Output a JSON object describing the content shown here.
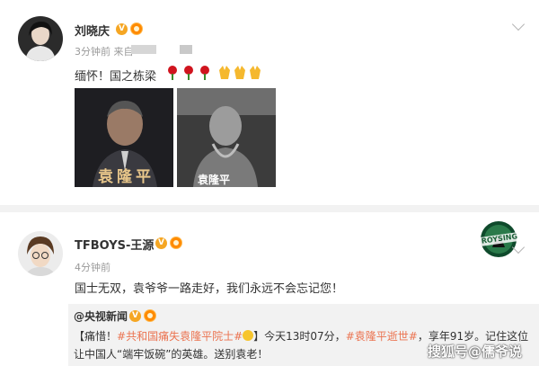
{
  "post1": {
    "author": "刘晓庆",
    "time": "3分钟前",
    "source_prefix": "来自",
    "text": "缅怀！国之栋梁",
    "emojis": [
      "rose",
      "rose",
      "rose",
      "praying-hands",
      "praying-hands",
      "praying-hands"
    ],
    "images": [
      {
        "caption": "袁隆平"
      },
      {
        "caption": "袁隆平"
      }
    ]
  },
  "post2": {
    "author": "TFBOYS-王源",
    "time": "4分钟前",
    "text": "国士无双，袁爷爷一路走好，我们永远不会忘记您！",
    "badge_text": "ROYSING",
    "repost": {
      "author": "@央视新闻",
      "line1_prefix": "【痛惜！",
      "line1_tag1": "#共和国痛失袁隆平院士#",
      "line1_mid": "】今天13时07分，",
      "line1_tag2": "#袁隆平逝世#",
      "line1_suffix": "，享年91岁。记住这位",
      "line2": "让中国人“端牢饭碗”的英雄。送别袁老！"
    }
  },
  "watermark": "搜狐号@儒爷说",
  "colors": {
    "accent": "#eb7350",
    "verified": "#f5a623",
    "repost_bg": "#f2f2f2"
  }
}
